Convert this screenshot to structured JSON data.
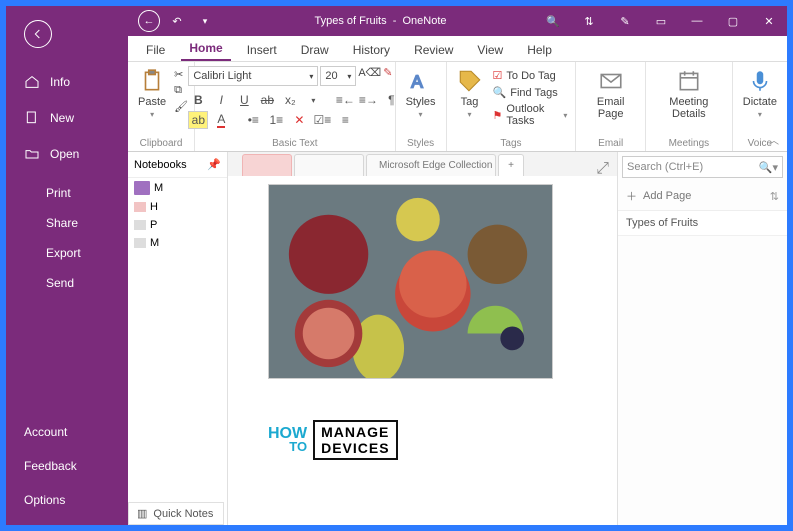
{
  "titlebar": {
    "doc_title": "Types of Fruits",
    "app_name": "OneNote"
  },
  "filemenu": {
    "info": "Info",
    "new": "New",
    "open": "Open",
    "print": "Print",
    "share": "Share",
    "export": "Export",
    "send": "Send",
    "account": "Account",
    "feedback": "Feedback",
    "options": "Options"
  },
  "menu": {
    "file": "File",
    "home": "Home",
    "insert": "Insert",
    "draw": "Draw",
    "history": "History",
    "review": "Review",
    "view": "View",
    "help": "Help"
  },
  "ribbon": {
    "clipboard": {
      "paste": "Paste",
      "label": "Clipboard"
    },
    "basictext": {
      "font": "Calibri Light",
      "size": "20",
      "label": "Basic Text"
    },
    "styles": {
      "btn": "Styles",
      "label": "Styles"
    },
    "tags": {
      "tag": "Tag",
      "todo": "To Do Tag",
      "find": "Find Tags",
      "outlook": "Outlook Tasks",
      "label": "Tags"
    },
    "email": {
      "btn": "Email Page",
      "label": "Email"
    },
    "meetings": {
      "btn": "Meeting Details",
      "label": "Meetings"
    },
    "voice": {
      "btn": "Dictate",
      "label": "Voice"
    }
  },
  "notebooks": {
    "header": "Notebooks",
    "items": [
      "M",
      "H",
      "P",
      "M"
    ],
    "quicknotes": "Quick Notes"
  },
  "tabs": {
    "tab_collection": "Microsoft Edge Collection"
  },
  "search": {
    "placeholder": "Search (Ctrl+E)"
  },
  "pagepanel": {
    "add": "Add Page",
    "pages": [
      "Types of Fruits"
    ]
  },
  "watermark": {
    "how": "HOW",
    "to": "TO",
    "manage": "MANAGE",
    "devices": "DEVICES"
  }
}
